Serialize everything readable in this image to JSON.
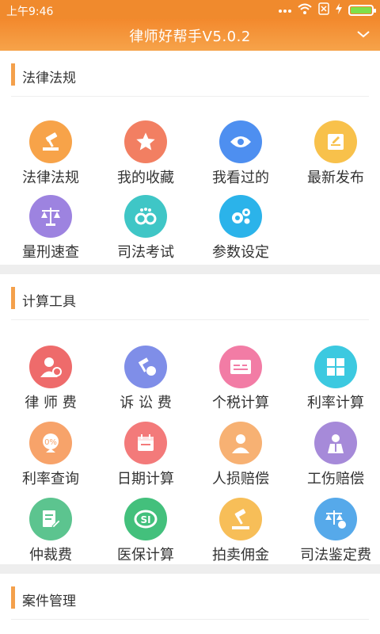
{
  "status_bar": {
    "time": "上午9:46"
  },
  "header": {
    "title": "律师好帮手V5.0.2"
  },
  "sections": [
    {
      "title": "法律法规",
      "items": [
        {
          "label": "法律法规",
          "icon": "gavel-icon",
          "color": "#f7a349"
        },
        {
          "label": "我的收藏",
          "icon": "star-icon",
          "color": "#f27f62"
        },
        {
          "label": "我看过的",
          "icon": "eye-icon",
          "color": "#4e8ff0"
        },
        {
          "label": "最新发布",
          "icon": "edit-icon",
          "color": "#f8c14b"
        },
        {
          "label": "量刑速查",
          "icon": "scales-icon",
          "color": "#9d83e0"
        },
        {
          "label": "司法考试",
          "icon": "handcuffs-icon",
          "color": "#3fc6c6"
        },
        {
          "label": "参数设定",
          "icon": "gears-icon",
          "color": "#2bb3ea"
        }
      ]
    },
    {
      "title": "计算工具",
      "items": [
        {
          "label": "律 师 费",
          "icon": "lawyer-icon",
          "color": "#ee6b6b"
        },
        {
          "label": "诉 讼 费",
          "icon": "gavel-money-icon",
          "color": "#7f8ee8"
        },
        {
          "label": "个税计算",
          "icon": "tax-card-icon",
          "color": "#f27ca5"
        },
        {
          "label": "利率计算",
          "icon": "calculator-icon",
          "color": "#3cc9e0"
        },
        {
          "label": "利率查询",
          "icon": "percent-icon",
          "color": "#f7a36a"
        },
        {
          "label": "日期计算",
          "icon": "calendar-icon",
          "color": "#f37a7a"
        },
        {
          "label": "人损赔偿",
          "icon": "person-icon",
          "color": "#f7b173"
        },
        {
          "label": "工伤赔偿",
          "icon": "worker-icon",
          "color": "#a68ad9"
        },
        {
          "label": "仲裁费",
          "icon": "document-pen-icon",
          "color": "#5cc48f"
        },
        {
          "label": "医保计算",
          "icon": "medical-insurance-icon",
          "color": "#43c07c"
        },
        {
          "label": "拍卖佣金",
          "icon": "auction-gavel-icon",
          "color": "#f7be58"
        },
        {
          "label": "司法鉴定费",
          "icon": "appraisal-scales-icon",
          "color": "#56a9ea"
        }
      ]
    },
    {
      "title": "案件管理",
      "items": []
    }
  ]
}
